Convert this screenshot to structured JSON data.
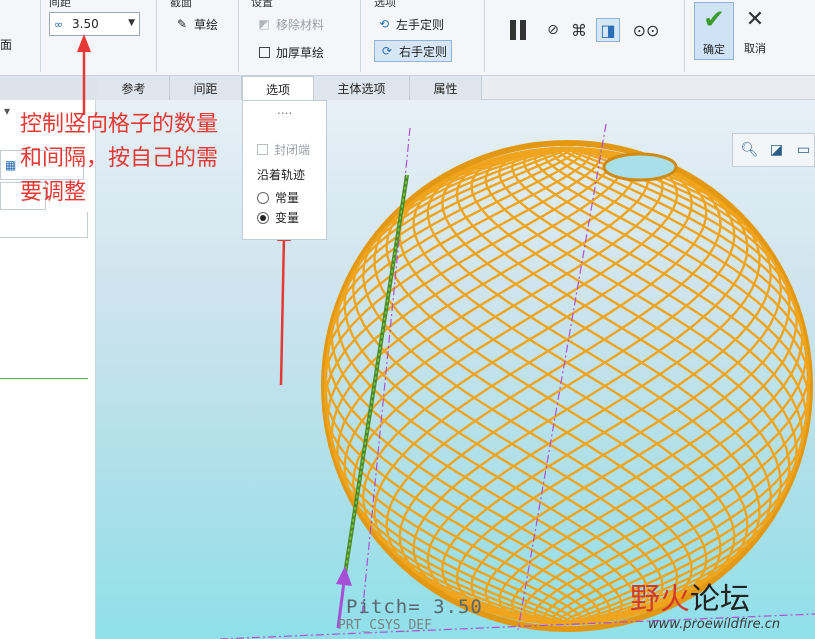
{
  "ribbon": {
    "groups": {
      "pitch": "间距",
      "section": "截面",
      "settings": "设置",
      "options": "选项"
    },
    "pitch_value": "3.50",
    "sketch_label": "草绘",
    "remove_material_label": "移除材料",
    "thicken_sketch_label": "加厚草绘",
    "left_handed_label": "左手定则",
    "right_handed_label": "右手定则",
    "ok_label": "确定",
    "cancel_label": "取消",
    "left_edge_text": "面"
  },
  "tabs": [
    {
      "label": "参考"
    },
    {
      "label": "间距"
    },
    {
      "label": "选项"
    },
    {
      "label": "主体选项"
    },
    {
      "label": "属性"
    }
  ],
  "options_popup": {
    "dots": "....",
    "closed_end_label": "封闭端",
    "along_trajectory_label": "沿着轨迹",
    "constant_label": "常量",
    "variable_label": "变量",
    "selected": "变量"
  },
  "annotation": {
    "line1": "控制竖向格子的数量",
    "line2": "和间隔，按自己的需",
    "line3": "要调整"
  },
  "viewport": {
    "pitch_readout": "Pitch= 3.50",
    "csys_text": "PRT_CSYS_DEF"
  },
  "watermark": {
    "brand_red": "野火",
    "brand_black": "论坛",
    "url": "www.proewildfire.cn"
  },
  "colors": {
    "sphere": "#f0a41c",
    "annotation": "#e53935",
    "accent": "#3a9b2e"
  }
}
